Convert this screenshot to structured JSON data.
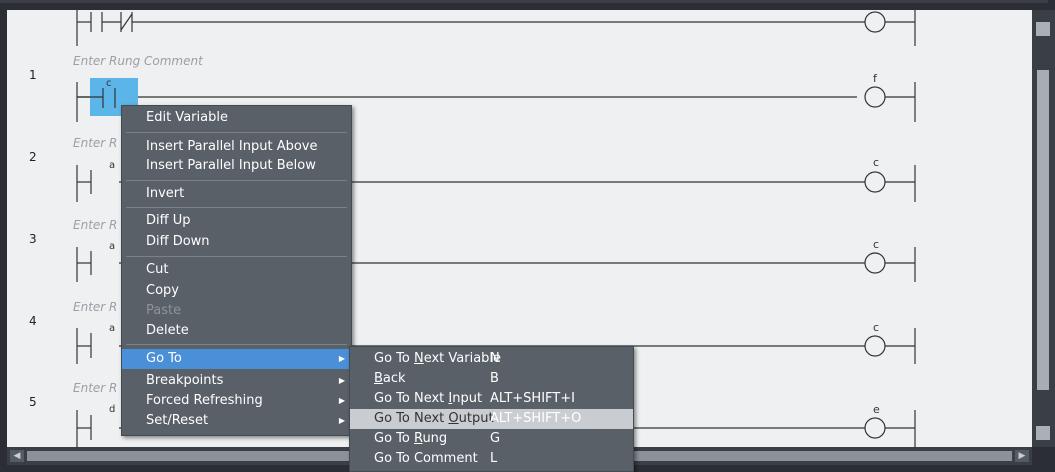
{
  "rungs": [
    {
      "number": "1",
      "comment": "Enter Rung Comment",
      "contact_var": "c",
      "coil_var": "f"
    },
    {
      "number": "2",
      "comment": "Enter R",
      "contact_var": "a",
      "coil_var": "c"
    },
    {
      "number": "3",
      "comment": "Enter R",
      "contact_var": "a",
      "coil_var": "c"
    },
    {
      "number": "4",
      "comment": "Enter R",
      "contact_var": "a",
      "coil_var": "c"
    },
    {
      "number": "5",
      "comment": "Enter R",
      "contact_var": "d",
      "coil_var": "e"
    }
  ],
  "context_menu": {
    "items": [
      {
        "label": "Edit Variable"
      },
      {
        "label": "Insert Parallel Input Above"
      },
      {
        "label": "Insert Parallel Input Below"
      },
      {
        "label": "Invert"
      },
      {
        "label": "Diff Up"
      },
      {
        "label": "Diff Down"
      },
      {
        "label": "Cut"
      },
      {
        "label": "Copy"
      },
      {
        "label": "Paste"
      },
      {
        "label": "Delete"
      },
      {
        "label": "Go To"
      },
      {
        "label": "Breakpoints"
      },
      {
        "label": "Forced Refreshing"
      },
      {
        "label": "Set/Reset"
      }
    ]
  },
  "goto_submenu": {
    "items": [
      {
        "pre": "Go To ",
        "u": "N",
        "post": "ext Variable",
        "shortcut": "N"
      },
      {
        "pre": "",
        "u": "B",
        "post": "ack",
        "shortcut": "B"
      },
      {
        "pre": "Go To Next ",
        "u": "I",
        "post": "nput",
        "shortcut": "ALT+SHIFT+I"
      },
      {
        "pre": "Go To Next ",
        "u": "O",
        "post": "utput",
        "shortcut": "ALT+SHIFT+O"
      },
      {
        "pre": "Go To ",
        "u": "R",
        "post": "ung",
        "shortcut": "G"
      },
      {
        "pre": "Go To Comment",
        "u": "",
        "post": "",
        "shortcut": "L"
      }
    ]
  },
  "colors": {
    "background": "#eef0f2",
    "selection": "#5bb5e8",
    "menu_bg": "#5a6068",
    "menu_highlight": "#4a90d9"
  }
}
